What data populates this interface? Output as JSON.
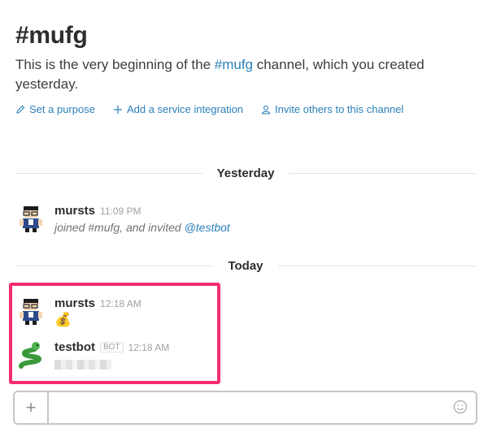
{
  "channel": {
    "title": "#mufg",
    "intro_pre": "This is the very beginning of the ",
    "intro_link": "#mufg",
    "intro_post": " channel, which you created yesterday."
  },
  "actions": [
    {
      "label": "Set a purpose",
      "icon": "pencil-icon"
    },
    {
      "label": "Add a service integration",
      "icon": "plus-icon"
    },
    {
      "label": "Invite others to this channel",
      "icon": "person-icon"
    }
  ],
  "dividers": {
    "yesterday": "Yesterday",
    "today": "Today"
  },
  "messages": [
    {
      "author": "mursts",
      "time": "11:09 PM",
      "text": "joined #mufg, and invited ",
      "mention": "@testbot",
      "avatar": "pixel-character-avatar"
    },
    {
      "author": "mursts",
      "time": "12:18 AM",
      "emoji": "💰",
      "avatar": "pixel-character-avatar"
    },
    {
      "author": "testbot",
      "badge": "BOT",
      "time": "12:18 AM",
      "avatar": "snake-emoji-avatar"
    }
  ],
  "composer": {
    "plus_label": "+",
    "placeholder": "",
    "emoji_icon": "smiley-icon"
  },
  "colors": {
    "link": "#2a80b9",
    "highlight": "#f52d6e"
  }
}
